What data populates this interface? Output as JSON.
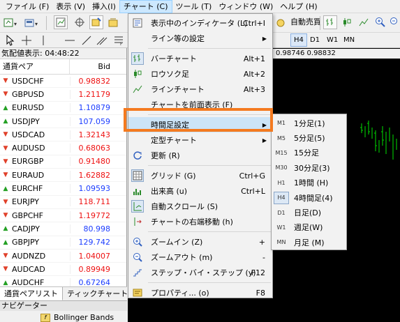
{
  "menubar": {
    "items": [
      "ファイル (F)",
      "表示 (V)",
      "挿入(I)",
      "チャート (C)",
      "ツール (T)",
      "ウィンドウ (W)",
      "ヘルプ (H)"
    ]
  },
  "toolbar": {
    "auto_trading": "自動売買"
  },
  "timeframes": [
    "H4",
    "D1",
    "W1",
    "MN"
  ],
  "chart_price_text": "0.98746 0.98832",
  "market_watch": {
    "title": "気配値表示: 04:48:22",
    "col_symbol": "通貨ペア",
    "col_bid": "Bid",
    "rows": [
      {
        "dir": "down",
        "symbol": "USDCHF",
        "bid": "0.98832",
        "color": "red"
      },
      {
        "dir": "down",
        "symbol": "GBPUSD",
        "bid": "1.21179",
        "color": "red"
      },
      {
        "dir": "up",
        "symbol": "EURUSD",
        "bid": "1.10879",
        "color": "blue"
      },
      {
        "dir": "up",
        "symbol": "USDJPY",
        "bid": "107.059",
        "color": "blue"
      },
      {
        "dir": "down",
        "symbol": "USDCAD",
        "bid": "1.32143",
        "color": "red"
      },
      {
        "dir": "down",
        "symbol": "AUDUSD",
        "bid": "0.68063",
        "color": "red"
      },
      {
        "dir": "down",
        "symbol": "EURGBP",
        "bid": "0.91480",
        "color": "red"
      },
      {
        "dir": "down",
        "symbol": "EURAUD",
        "bid": "1.62882",
        "color": "red"
      },
      {
        "dir": "up",
        "symbol": "EURCHF",
        "bid": "1.09593",
        "color": "blue"
      },
      {
        "dir": "down",
        "symbol": "EURJPY",
        "bid": "118.711",
        "color": "red"
      },
      {
        "dir": "down",
        "symbol": "GBPCHF",
        "bid": "1.19772",
        "color": "red"
      },
      {
        "dir": "up",
        "symbol": "CADJPY",
        "bid": "80.998",
        "color": "blue"
      },
      {
        "dir": "up",
        "symbol": "GBPJPY",
        "bid": "129.742",
        "color": "blue"
      },
      {
        "dir": "down",
        "symbol": "AUDNZD",
        "bid": "1.04007",
        "color": "red"
      },
      {
        "dir": "down",
        "symbol": "AUDCAD",
        "bid": "0.89949",
        "color": "red"
      },
      {
        "dir": "up",
        "symbol": "AUDCHF",
        "bid": "0.67264",
        "color": "blue"
      }
    ],
    "tabs": [
      "通貨ペアリスト",
      "ティックチャート"
    ]
  },
  "navigator": {
    "title": "ナビゲーター",
    "item": "Bollinger Bands"
  },
  "chart_menu": {
    "items": [
      {
        "label": "表示中のインディケータ (L)",
        "shortcut": "Ctrl+I",
        "icon": "indicator-list-icon"
      },
      {
        "label": "ライン等の設定",
        "submenu": true
      },
      {
        "separator": true
      },
      {
        "label": "バーチャート",
        "shortcut": "Alt+1",
        "icon": "bar-chart-icon"
      },
      {
        "label": "ロウソク足",
        "shortcut": "Alt+2",
        "icon": "candlestick-icon"
      },
      {
        "label": "ラインチャート",
        "shortcut": "Alt+3",
        "icon": "line-chart-icon"
      },
      {
        "label": "チャートを前面表示 (F)"
      },
      {
        "separator": true
      },
      {
        "label": "時間足設定",
        "submenu": true,
        "highlighted": true
      },
      {
        "label": "定型チャート",
        "submenu": true
      },
      {
        "label": "更新 (R)",
        "icon": "refresh-icon"
      },
      {
        "separator": true
      },
      {
        "label": "グリッド (G)",
        "shortcut": "Ctrl+G",
        "icon": "grid-icon"
      },
      {
        "label": "出来高 (u)",
        "shortcut": "Ctrl+L",
        "icon": "volume-icon"
      },
      {
        "label": "自動スクロール (S)",
        "icon": "auto-scroll-icon"
      },
      {
        "label": "チャートの右端移動 (h)",
        "icon": "chart-shift-icon"
      },
      {
        "separator": true
      },
      {
        "label": "ズームイン (Z)",
        "shortcut": "+",
        "icon": "zoom-in-icon"
      },
      {
        "label": "ズームアウト (m)",
        "shortcut": "-",
        "icon": "zoom-out-icon"
      },
      {
        "label": "ステップ・バイ・ステップ (y)",
        "shortcut": "F12",
        "icon": "step-icon"
      },
      {
        "separator": true
      },
      {
        "label": "プロパティ... (o)",
        "shortcut": "F8",
        "icon": "properties-icon"
      }
    ]
  },
  "timeframe_menu": {
    "items": [
      {
        "code": "M1",
        "label": "1分足(1)"
      },
      {
        "code": "M5",
        "label": "5分足(5)"
      },
      {
        "code": "M15",
        "label": "15分足"
      },
      {
        "code": "M30",
        "label": "30分足(3)"
      },
      {
        "code": "H1",
        "label": "1時間 (H)"
      },
      {
        "code": "H4",
        "label": "4時間足(4)",
        "selected": true
      },
      {
        "code": "D1",
        "label": "日足(D)"
      },
      {
        "code": "W1",
        "label": "週足(W)"
      },
      {
        "code": "MN",
        "label": "月足 (M)"
      }
    ]
  }
}
